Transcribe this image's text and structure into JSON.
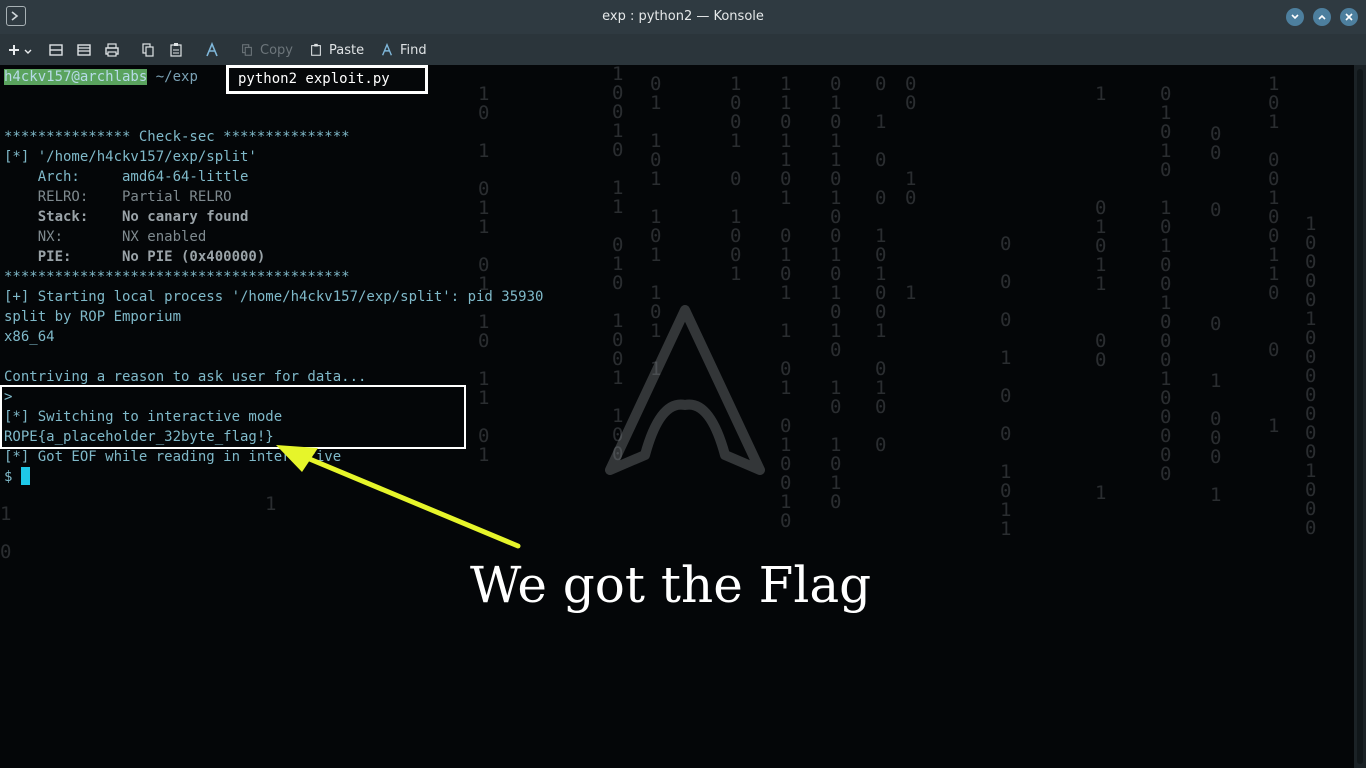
{
  "window": {
    "title": "exp : python2 — Konsole",
    "accent": "#4d7f9e"
  },
  "toolbar": {
    "new_tab_icon": "plus-icon",
    "copy_label": "Copy",
    "paste_label": "Paste",
    "find_label": "Find"
  },
  "terminal": {
    "prompt_user": "h4ckv157@archlabs",
    "prompt_path": "~/exp",
    "command": "python2 exploit.py",
    "lines": [
      "*************** Check-sec ***************",
      "[*] '/home/h4ckv157/exp/split'",
      "    Arch:     amd64-64-little",
      "    RELRO:    Partial RELRO",
      "    Stack:    No canary found",
      "    NX:       NX enabled",
      "    PIE:      No PIE (0x400000)",
      "*****************************************",
      "[+] Starting local process '/home/h4ckv157/exp/split': pid 35930",
      "split by ROP Emporium",
      "x86_64",
      "",
      "Contriving a reason to ask user for data...",
      ">",
      "[*] Switching to interactive mode",
      "ROPE{a_placeholder_32byte_flag!}",
      "[*] Got EOF while reading in interactive",
      "$ "
    ]
  },
  "annotation": {
    "text": "We got the Flag",
    "arrow_color": "#e6f52a"
  }
}
